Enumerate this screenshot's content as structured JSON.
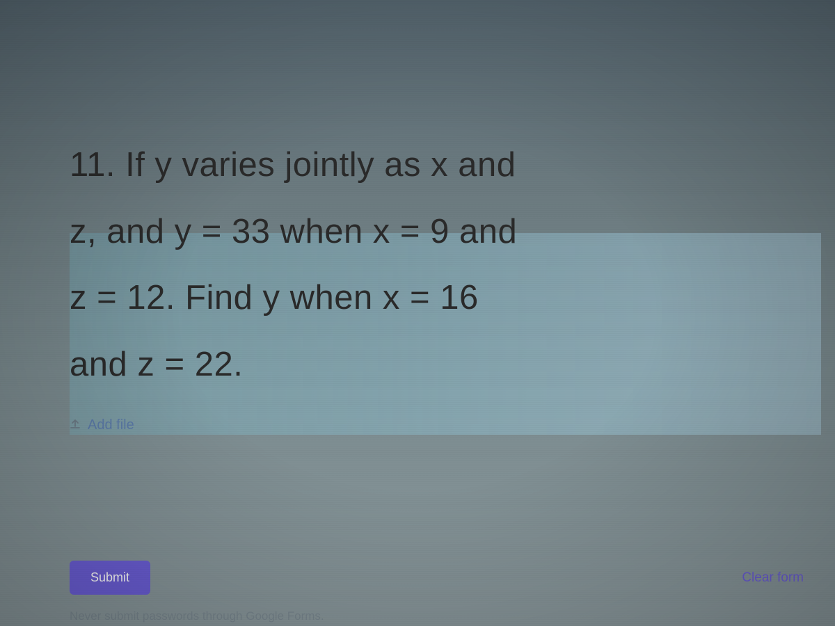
{
  "question": {
    "line1": "11. If  y varies jointly as x and",
    "line2": "z, and y = 33 when x = 9 and",
    "line3": "z = 12. Find y when x = 16",
    "line4": "and z = 22."
  },
  "addFileLabel": "Add file",
  "submitLabel": "Submit",
  "clearFormLabel": "Clear form",
  "disclaimer": "Never submit passwords through Google Forms."
}
